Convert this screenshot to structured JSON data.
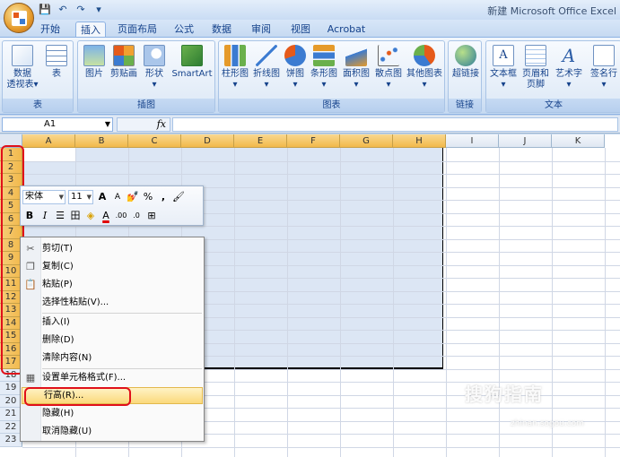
{
  "window": {
    "title": "新建 Microsoft Office Excel"
  },
  "qat": {
    "save": "💾",
    "undo": "↶",
    "redo": "↷",
    "customize": "▾"
  },
  "tabs": [
    "开始",
    "插入",
    "页面布局",
    "公式",
    "数据",
    "审阅",
    "视图",
    "Acrobat"
  ],
  "active_tab": "插入",
  "ribbon": {
    "groups": [
      {
        "name": "表",
        "buttons": [
          {
            "label1": "数据",
            "label2": "透视表▾",
            "icon": "pivot-table-icon"
          },
          {
            "label1": "表",
            "label2": "",
            "icon": "table-icon"
          }
        ]
      },
      {
        "name": "插图",
        "buttons": [
          {
            "label1": "图片",
            "icon": "picture-icon"
          },
          {
            "label1": "剪贴画",
            "icon": "clipart-icon"
          },
          {
            "label1": "形状",
            "label2": "▾",
            "icon": "shapes-icon"
          },
          {
            "label1": "SmartArt",
            "icon": "smartart-icon"
          }
        ]
      },
      {
        "name": "图表",
        "buttons": [
          {
            "label1": "柱形图",
            "icon": "column-chart-icon"
          },
          {
            "label1": "折线图",
            "icon": "line-chart-icon"
          },
          {
            "label1": "饼图",
            "icon": "pie-chart-icon"
          },
          {
            "label1": "条形图",
            "icon": "bar-chart-icon"
          },
          {
            "label1": "面积图",
            "icon": "area-chart-icon"
          },
          {
            "label1": "散点图",
            "icon": "scatter-chart-icon"
          },
          {
            "label1": "其他图表",
            "icon": "other-charts-icon"
          }
        ]
      },
      {
        "name": "链接",
        "buttons": [
          {
            "label1": "超链接",
            "icon": "hyperlink-icon"
          }
        ]
      },
      {
        "name": "文本",
        "buttons": [
          {
            "label1": "文本框",
            "label2": "▾",
            "icon": "textbox-icon"
          },
          {
            "label1": "页眉和",
            "label2": "页脚",
            "icon": "header-footer-icon"
          },
          {
            "label1": "艺术字",
            "label2": "▾",
            "icon": "wordart-icon"
          },
          {
            "label1": "签名行",
            "label2": "▾",
            "icon": "signature-icon"
          }
        ]
      }
    ]
  },
  "formula_bar": {
    "name_box": "A1",
    "fx": "fx",
    "value": ""
  },
  "grid": {
    "columns": [
      "A",
      "B",
      "C",
      "D",
      "E",
      "F",
      "G",
      "H",
      "I",
      "J",
      "K"
    ],
    "rows": [
      "1",
      "2",
      "3",
      "4",
      "5",
      "6",
      "7",
      "8",
      "9",
      "10",
      "11",
      "12",
      "13",
      "14",
      "15",
      "16",
      "17",
      "18",
      "19",
      "20",
      "21",
      "22",
      "23"
    ]
  },
  "mini_toolbar": {
    "font": "宋体",
    "size": "11",
    "grow": "A",
    "shrink": "A",
    "format": "💅",
    "percent": "%",
    "comma": ",",
    "painter": "🖌",
    "bold": "B",
    "italic": "I",
    "center": "☰",
    "borders": "田",
    "fill": "◈",
    "fontcolor": "A",
    "inc_decimal": ".00",
    "dec_decimal": ".0",
    "merge": "⊞"
  },
  "context_menu": {
    "items": [
      {
        "label": "剪切(T)",
        "icon": "✂"
      },
      {
        "label": "复制(C)",
        "icon": "❐"
      },
      {
        "label": "粘贴(P)",
        "icon": "📋"
      },
      {
        "label": "选择性粘贴(V)..."
      },
      {
        "label": "插入(I)"
      },
      {
        "label": "删除(D)"
      },
      {
        "label": "清除内容(N)"
      },
      {
        "label": "设置单元格格式(F)...",
        "icon": "▦"
      },
      {
        "label": "行高(R)..."
      },
      {
        "label": "隐藏(H)"
      },
      {
        "label": "取消隐藏(U)"
      }
    ]
  },
  "watermark": {
    "text": "搜狗指南",
    "sub": "zhinan.sogou.com"
  },
  "colors": {
    "selection": "#dce6f4",
    "highlight": "#e0101a",
    "header_active": "#f2b94b"
  }
}
